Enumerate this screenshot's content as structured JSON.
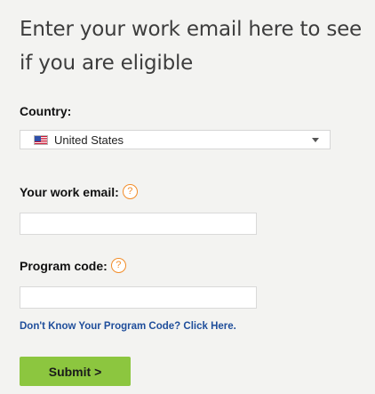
{
  "form": {
    "headline": "Enter your work email here to see if you are eligible",
    "country": {
      "label": "Country:",
      "selected": "United States",
      "flag_icon": "us-flag-icon",
      "caret_icon": "chevron-down-icon"
    },
    "email": {
      "label": "Your work email:",
      "help_icon": "?",
      "value": "",
      "placeholder": ""
    },
    "program_code": {
      "label": "Program code:",
      "help_icon": "?",
      "value": "",
      "placeholder": ""
    },
    "help_link": "Don't Know Your Program Code? Click Here.",
    "submit_label": "Submit >"
  },
  "colors": {
    "background": "#f3f3f1",
    "submit_green": "#8cc63f",
    "link_blue": "#1f4e9b",
    "help_orange": "#f28c28"
  }
}
